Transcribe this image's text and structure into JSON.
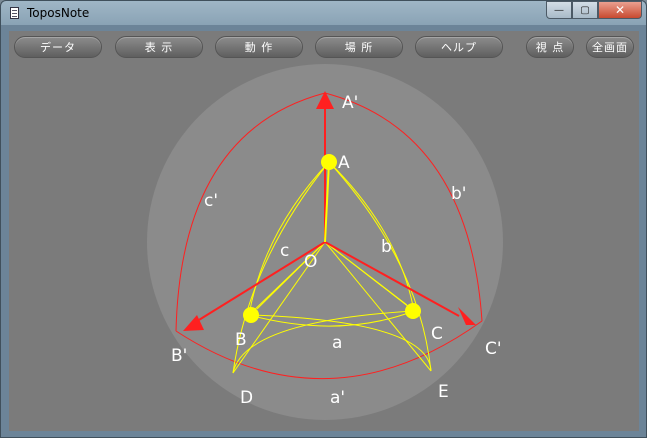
{
  "window": {
    "title": "ToposNote"
  },
  "titlebar_buttons": {
    "minimize": "—",
    "maximize": "▢",
    "close": "✕"
  },
  "toolbar": {
    "data": "データ",
    "view": "表 示",
    "action": "動 作",
    "place": "場 所",
    "help": "ヘルプ",
    "viewpoint": "視 点",
    "fullscreen": "全画面"
  },
  "canvas": {
    "points": {
      "A": "A",
      "B": "B",
      "C": "C",
      "O": "O",
      "D": "D",
      "E": "E"
    },
    "primes": {
      "A": "A'",
      "B": "B'",
      "C": "C'"
    },
    "edges": {
      "a": "a",
      "b": "b",
      "c": "c",
      "a_prime": "a'",
      "b_prime": "b'",
      "c_prime": "c'"
    },
    "colors": {
      "sphere": "#8b8b8b",
      "axes": "#ff1a1a",
      "geodesics": "#ffff00",
      "labels": "#ffffff"
    }
  }
}
